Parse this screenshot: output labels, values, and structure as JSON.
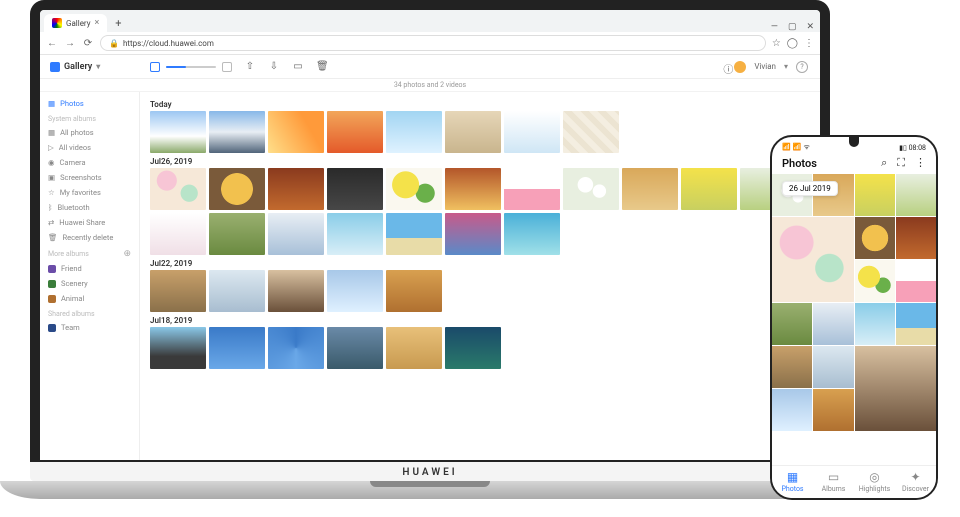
{
  "laptop_brand": "HUAWEI",
  "browser": {
    "tab_title": "Gallery",
    "url": "https://cloud.huawei.com"
  },
  "app": {
    "title": "Gallery",
    "count_text": "34 photos and 2 videos",
    "user_name": "Vivian"
  },
  "sidebar": {
    "main": {
      "label": "Photos"
    },
    "section_system": "System albums",
    "system_items": [
      {
        "label": "All photos"
      },
      {
        "label": "All videos"
      },
      {
        "label": "Camera"
      },
      {
        "label": "Screenshots"
      },
      {
        "label": "My favorites"
      },
      {
        "label": "Bluetooth"
      },
      {
        "label": "Huawei Share"
      },
      {
        "label": "Recently delete"
      }
    ],
    "section_more": "More albums",
    "more_items": [
      {
        "label": "Friend"
      },
      {
        "label": "Scenery"
      },
      {
        "label": "Animal"
      }
    ],
    "section_shared": "Shared albums",
    "shared_items": [
      {
        "label": "Team"
      }
    ]
  },
  "groups": [
    {
      "label": "Today"
    },
    {
      "label": "Jul26, 2019"
    },
    {
      "label": "Jul22, 2019"
    },
    {
      "label": "Jul18, 2019"
    }
  ],
  "phone": {
    "status_time": "08:08",
    "title": "Photos",
    "date_chip": "26 Jul 2019",
    "nav": [
      {
        "label": "Photos"
      },
      {
        "label": "Albums"
      },
      {
        "label": "Highlights"
      },
      {
        "label": "Discover"
      }
    ]
  }
}
